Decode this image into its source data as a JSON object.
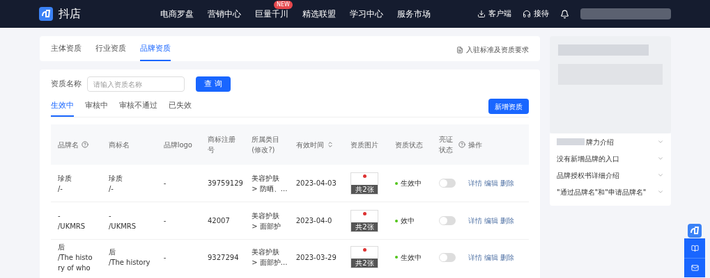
{
  "top_nav": {
    "logo": "抖店",
    "items": [
      {
        "label": "电商罗盘"
      },
      {
        "label": "营销中心"
      },
      {
        "label": "巨量千川",
        "badge": "NEW"
      },
      {
        "label": "精选联盟"
      },
      {
        "label": "学习中心"
      },
      {
        "label": "服务市场"
      }
    ],
    "client": "客户端",
    "reception": "接待"
  },
  "page_tabs": [
    {
      "label": "主体资质",
      "selected": false
    },
    {
      "label": "行业资质",
      "selected": false
    },
    {
      "label": "品牌资质",
      "selected": true
    }
  ],
  "requirements_link": "入驻标准及资质要求",
  "filter": {
    "label": "资质名称",
    "placeholder": "请输入资质名称",
    "button": "查 询"
  },
  "status_tabs": [
    {
      "label": "生效中",
      "selected": true
    },
    {
      "label": "审核中",
      "selected": false
    },
    {
      "label": "审核不通过",
      "selected": false
    },
    {
      "label": "已失效",
      "selected": false
    }
  ],
  "add_button": "新增资质",
  "table": {
    "columns": [
      "品牌名",
      "商标名",
      "品牌logo",
      "商标注册号",
      "所属类目(修改?)",
      "有效时间",
      "资质图片",
      "资质状态",
      "亮证状态",
      "操作"
    ],
    "rows": [
      {
        "brand": [
          "珍质",
          "/-"
        ],
        "trademark": [
          "珍质",
          "/-"
        ],
        "logo": "-",
        "reg_no": "39759129",
        "category": [
          "美容护肤",
          "> 防晒、..."
        ],
        "valid": "2023-04-03",
        "image_count": "共2张",
        "status": "生效中",
        "on": false,
        "actions": [
          "详情",
          "编辑",
          "删除"
        ]
      },
      {
        "brand": [
          "-",
          "/UKMRS"
        ],
        "trademark": [
          "-",
          "/UKMRS"
        ],
        "logo": "-",
        "reg_no": "42007",
        "category": [
          "美容护肤",
          "> 面部护"
        ],
        "valid": "2023-04-0",
        "image_count": "共2张",
        "status": "效中",
        "on": false,
        "actions": [
          "详情",
          "编辑",
          "删除"
        ]
      },
      {
        "brand": [
          "后",
          "/The histo",
          "ry of who"
        ],
        "trademark": [
          "后",
          "/The history"
        ],
        "logo": "-",
        "reg_no": "9327294",
        "category": [
          "美容护肤",
          "> 面部护..."
        ],
        "valid": "2023-03-29",
        "image_count": "共2张",
        "status": "生效中",
        "on": false,
        "actions": [
          "详情",
          "编辑",
          "删除"
        ]
      }
    ]
  },
  "faq": [
    "牌力介绍",
    "没有新增品牌的入口",
    "品牌授权书详细介绍",
    "\"通过品牌名\"和\"申请品牌名\""
  ]
}
